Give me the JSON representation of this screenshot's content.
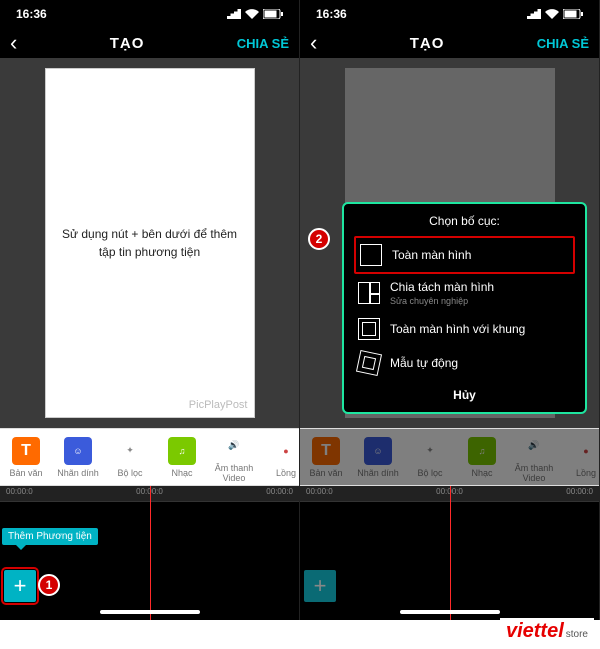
{
  "status": {
    "time": "16:36"
  },
  "nav": {
    "title": "TẠO",
    "share": "CHIA SẺ"
  },
  "left": {
    "placeholder": "Sử dụng nút + bên dưới để thêm tập tin phương tiện",
    "watermark": "PicPlayPost",
    "tooltip": "Thêm Phương tiện",
    "add": "+",
    "callout": "1"
  },
  "right": {
    "modal": {
      "title": "Chọn bố cục:",
      "opt_full": "Toàn màn hình",
      "opt_split": "Chia tách màn hình",
      "opt_split_sub": "Sửa chuyên nghiệp",
      "opt_frame": "Toàn màn hình với khung",
      "opt_auto": "Mẫu tự động",
      "cancel": "Hủy"
    },
    "callout": "2",
    "add": "+"
  },
  "toolbar": {
    "text": "Bản văn",
    "text_icon": "T",
    "sticker": "Nhãn dính",
    "filter": "Bộ lọc",
    "music": "Nhạc",
    "audio": "Âm thanh Video",
    "dub": "Lồng"
  },
  "timeline": {
    "t0": "00:00:0",
    "t1": "00:00:0",
    "t2": "00:00:0"
  },
  "brand": {
    "main": "viettel",
    "sub": "store"
  }
}
